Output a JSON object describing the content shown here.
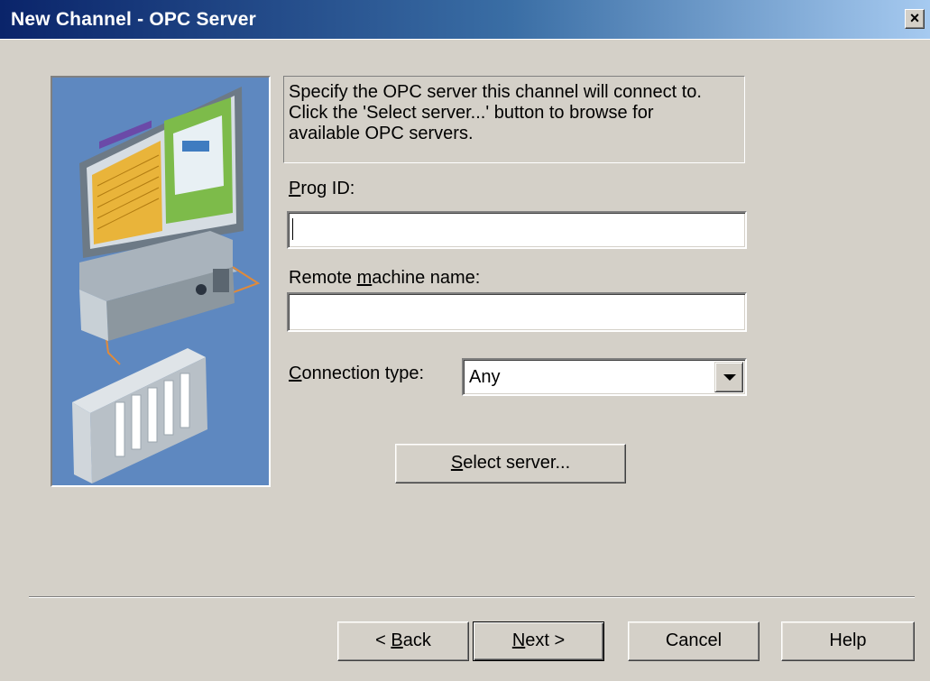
{
  "window": {
    "title": "New Channel - OPC Server",
    "close_glyph": "×"
  },
  "description": {
    "lines": [
      "Specify the OPC server this channel will connect to.",
      "Click the 'Select server...' button to browse for",
      "available OPC servers."
    ]
  },
  "prog_id": {
    "label_mnemonic": "P",
    "label_rest": "rog ID:",
    "value": ""
  },
  "remote_machine": {
    "label_before": "Remote ",
    "label_mnemonic": "m",
    "label_after": "achine name:",
    "value": ""
  },
  "connection_type": {
    "label_mnemonic": "C",
    "label_rest": "onnection type:",
    "value": "Any"
  },
  "select_server_button": {
    "mnemonic": "S",
    "rest": "elect server..."
  },
  "footer": {
    "back_prefix": "< ",
    "back_mnemonic": "B",
    "back_rest": "ack",
    "next_mnemonic": "N",
    "next_rest": "ext >",
    "cancel_label": "Cancel",
    "help_label": "Help"
  },
  "colors": {
    "dialog_bg": "#d4d0c8",
    "title_gradient_start": "#0a246a",
    "title_gradient_end": "#a6caf0",
    "wizard_image_bg": "#5e88c0"
  }
}
